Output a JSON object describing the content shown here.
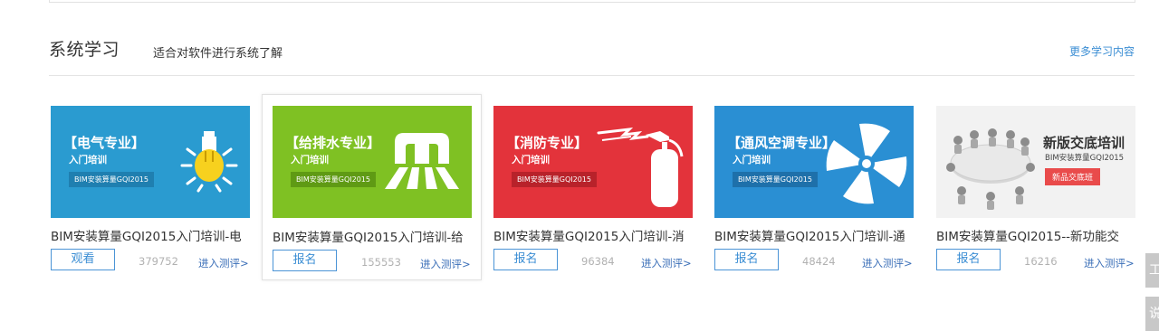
{
  "section": {
    "title": "系统学习",
    "subtitle": "适合对软件进行系统了解",
    "more_link": "更多学习内容"
  },
  "courses": [
    {
      "thumb_title": "【电气专业】",
      "thumb_sub": "入门培训",
      "thumb_tag": "BIM安装算量GQI2015",
      "thumb_bg": "#2a9bd0",
      "thumb_icon": "lightbulb-icon",
      "name": "BIM安装算量GQI2015入门培训-电",
      "action": "观看",
      "count": "379752",
      "eval": "进入测评>"
    },
    {
      "thumb_title": "【给排水专业】",
      "thumb_sub": "入门培训",
      "thumb_tag": "BIM安装算量GQI2015",
      "thumb_bg": "#7fc123",
      "thumb_icon": "water-pipe-icon",
      "name": "BIM安装算量GQI2015入门培训-给",
      "action": "报名",
      "count": "155553",
      "eval": "进入测评>"
    },
    {
      "thumb_title": "【消防专业】",
      "thumb_sub": "入门培训",
      "thumb_tag": "BIM安装算量GQI2015",
      "thumb_bg": "#e3333b",
      "thumb_icon": "fire-extinguisher-icon",
      "name": "BIM安装算量GQI2015入门培训-消",
      "action": "报名",
      "count": "96384",
      "eval": "进入测评>"
    },
    {
      "thumb_title": "【通风空调专业】",
      "thumb_sub": "入门培训",
      "thumb_tag": "BIM安装算量GQI2015",
      "thumb_bg": "#2a8fd3",
      "thumb_icon": "fan-icon",
      "name": "BIM安装算量GQI2015入门培训-通",
      "action": "报名",
      "count": "48424",
      "eval": "进入测评>"
    },
    {
      "thumb_title": "新版交底培训",
      "thumb_sub": "BIM安装算量GQI2015",
      "thumb_tag": "新品交底班",
      "thumb_bg": "#f2f2f2",
      "thumb_icon": "meeting-table-icon",
      "name": "BIM安装算量GQI2015--新功能交",
      "action": "报名",
      "count": "16216",
      "eval": "进入测评>"
    }
  ],
  "side_tabs": [
    "工",
    "说"
  ]
}
